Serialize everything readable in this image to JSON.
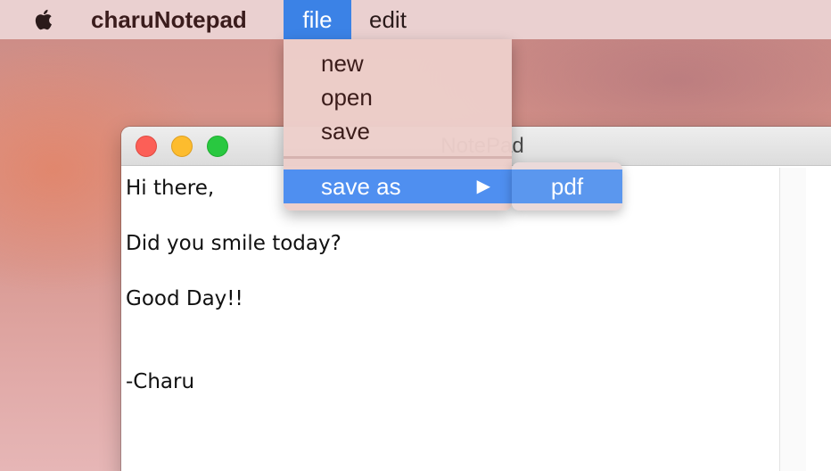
{
  "menubar": {
    "apple_icon": "apple-logo-icon",
    "app_name": "charuNotepad",
    "menus": [
      {
        "label": "file",
        "active": true
      },
      {
        "label": "edit",
        "active": false
      }
    ]
  },
  "window": {
    "title": "NotePad",
    "content_lines": [
      "Hi there,",
      "",
      "Did you smile today?",
      "",
      "Good Day!!",
      "",
      "",
      "-Charu"
    ]
  },
  "file_menu": {
    "items": [
      {
        "label": "new"
      },
      {
        "label": "open"
      },
      {
        "label": "save"
      },
      {
        "label": "save as",
        "has_submenu": true,
        "highlighted": true
      }
    ],
    "submenu_arrow": "▶"
  },
  "saveas_submenu": {
    "items": [
      {
        "label": "pdf",
        "highlighted": true
      }
    ]
  },
  "colors": {
    "menu_highlight": "#3b82e6",
    "item_highlight": "#4f8ff0",
    "close": "#fc5f57",
    "minimize": "#fdbc2e",
    "maximize": "#29c840"
  }
}
